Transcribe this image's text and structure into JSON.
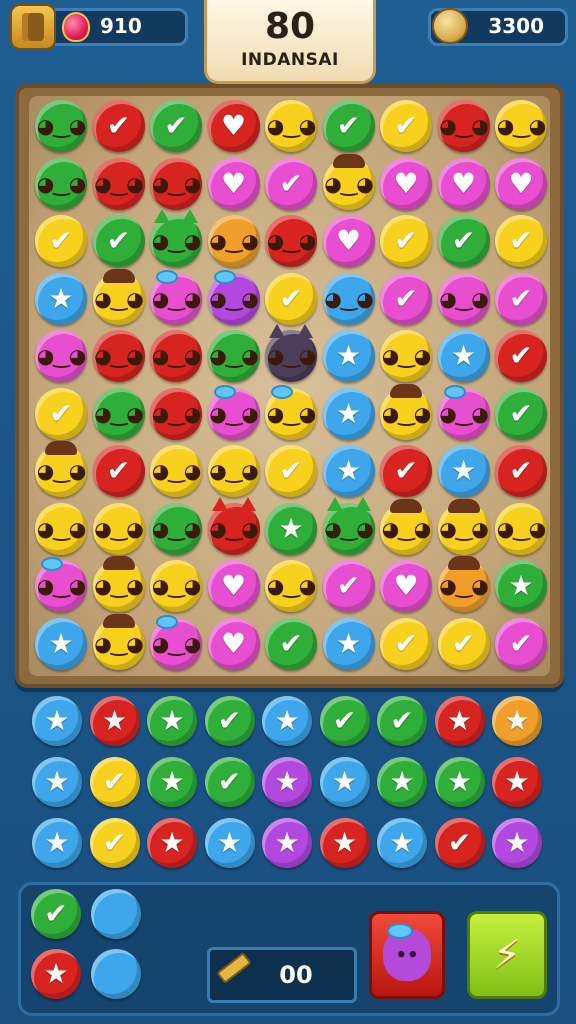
{
  "header": {
    "gems": "910",
    "coins": "3300",
    "level_number": "80",
    "level_name": "INDANSAI"
  },
  "icons": {
    "menu": "menu-book-icon",
    "gem": "heart-gem-icon",
    "coin": "clover-coin-icon",
    "pencil": "pencil-icon",
    "character": "purple-character-icon",
    "go": "lightning-icon"
  },
  "colors": {
    "green": "#2fae3a",
    "red": "#d72420",
    "yellow": "#f8d01e",
    "blue": "#3ea6ea",
    "pink": "#e84fd0",
    "purple": "#b348e0",
    "orange": "#f0a02a",
    "dark": "#4c3d58"
  },
  "board": {
    "rows": [
      [
        "green face",
        "red check",
        "green check",
        "red heart",
        "yellow face",
        "green check",
        "yellow check",
        "red face",
        "yellow face"
      ],
      [
        "green face",
        "red face",
        "red face",
        "pink heart",
        "pink check",
        "yellow face hair",
        "pink heart",
        "pink heart",
        "pink heart"
      ],
      [
        "yellow check",
        "green check",
        "green face ears",
        "orange face",
        "red face",
        "pink heart",
        "yellow check",
        "green check",
        "yellow check"
      ],
      [
        "blue star",
        "yellow face hair",
        "pink face bow",
        "purple face bow",
        "yellow check",
        "blue face",
        "pink check",
        "pink face",
        "pink check"
      ],
      [
        "pink face",
        "red face",
        "red face",
        "green face",
        "dark face ears",
        "blue star",
        "yellow face",
        "blue star",
        "red check"
      ],
      [
        "yellow check",
        "green face",
        "red face",
        "pink face bow",
        "yellow face bow",
        "blue star",
        "yellow face hair",
        "pink face bow",
        "green check"
      ],
      [
        "yellow face hair",
        "red check",
        "yellow face",
        "yellow face",
        "yellow check",
        "blue star",
        "red check",
        "blue star",
        "red check"
      ],
      [
        "yellow face",
        "yellow face",
        "green face",
        "red face ears",
        "green star",
        "green face ears",
        "yellow face hair",
        "yellow face hair",
        "yellow face"
      ],
      [
        "pink face bow",
        "yellow face hair",
        "yellow face",
        "pink heart",
        "yellow face",
        "pink check",
        "pink heart",
        "orange face hair",
        "green star"
      ],
      [
        "blue star",
        "yellow face hair",
        "pink face bow",
        "pink heart",
        "green check",
        "blue star",
        "yellow check",
        "yellow check",
        "pink check"
      ]
    ]
  },
  "tray": {
    "rows": [
      [
        "blue star",
        "red star",
        "green star",
        "green check",
        "blue star",
        "green check",
        "green check",
        "red star",
        "orange star"
      ],
      [
        "blue star",
        "yellow check",
        "green star",
        "green check",
        "purple star",
        "blue star",
        "green star",
        "green star",
        "red star"
      ],
      [
        "blue star",
        "yellow check",
        "red star",
        "blue star",
        "purple star",
        "red star",
        "blue star",
        "red check",
        "purple star"
      ]
    ]
  },
  "bottom": {
    "queue": [
      "green check",
      "blue blank",
      "red star",
      "blue blank"
    ],
    "counter": "00"
  }
}
